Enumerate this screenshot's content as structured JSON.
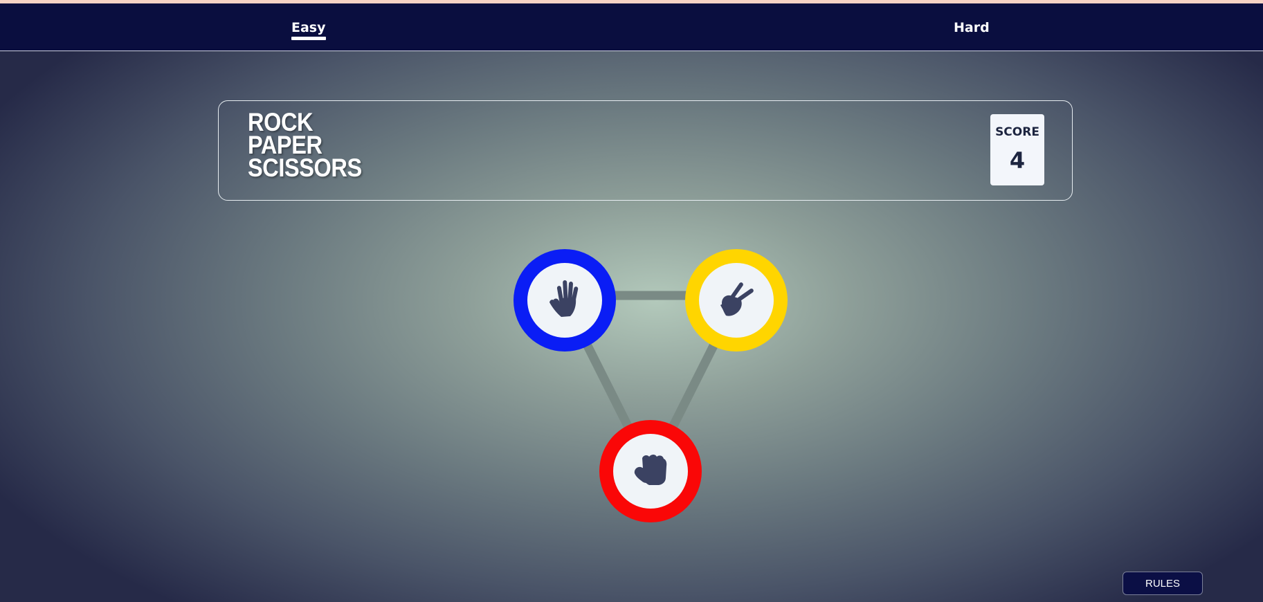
{
  "nav": {
    "tabs": [
      {
        "label": "Easy",
        "active": true
      },
      {
        "label": "Hard",
        "active": false
      }
    ]
  },
  "header": {
    "title_lines": [
      "ROCK",
      "PAPER",
      "SCISSORS"
    ],
    "score_label": "SCORE",
    "score_value": "4"
  },
  "choices": [
    {
      "name": "paper",
      "icon": "paper-hand-icon",
      "ring_color": "#0a1df5"
    },
    {
      "name": "scissors",
      "icon": "scissors-hand-icon",
      "ring_color": "#ffd500"
    },
    {
      "name": "rock",
      "icon": "rock-fist-icon",
      "ring_color": "#fa0707"
    }
  ],
  "rules_button": {
    "label": "RULES"
  },
  "colors": {
    "navbar": "#0a0e3f",
    "icon": "#3b4262",
    "connector": "#7a8a85"
  }
}
